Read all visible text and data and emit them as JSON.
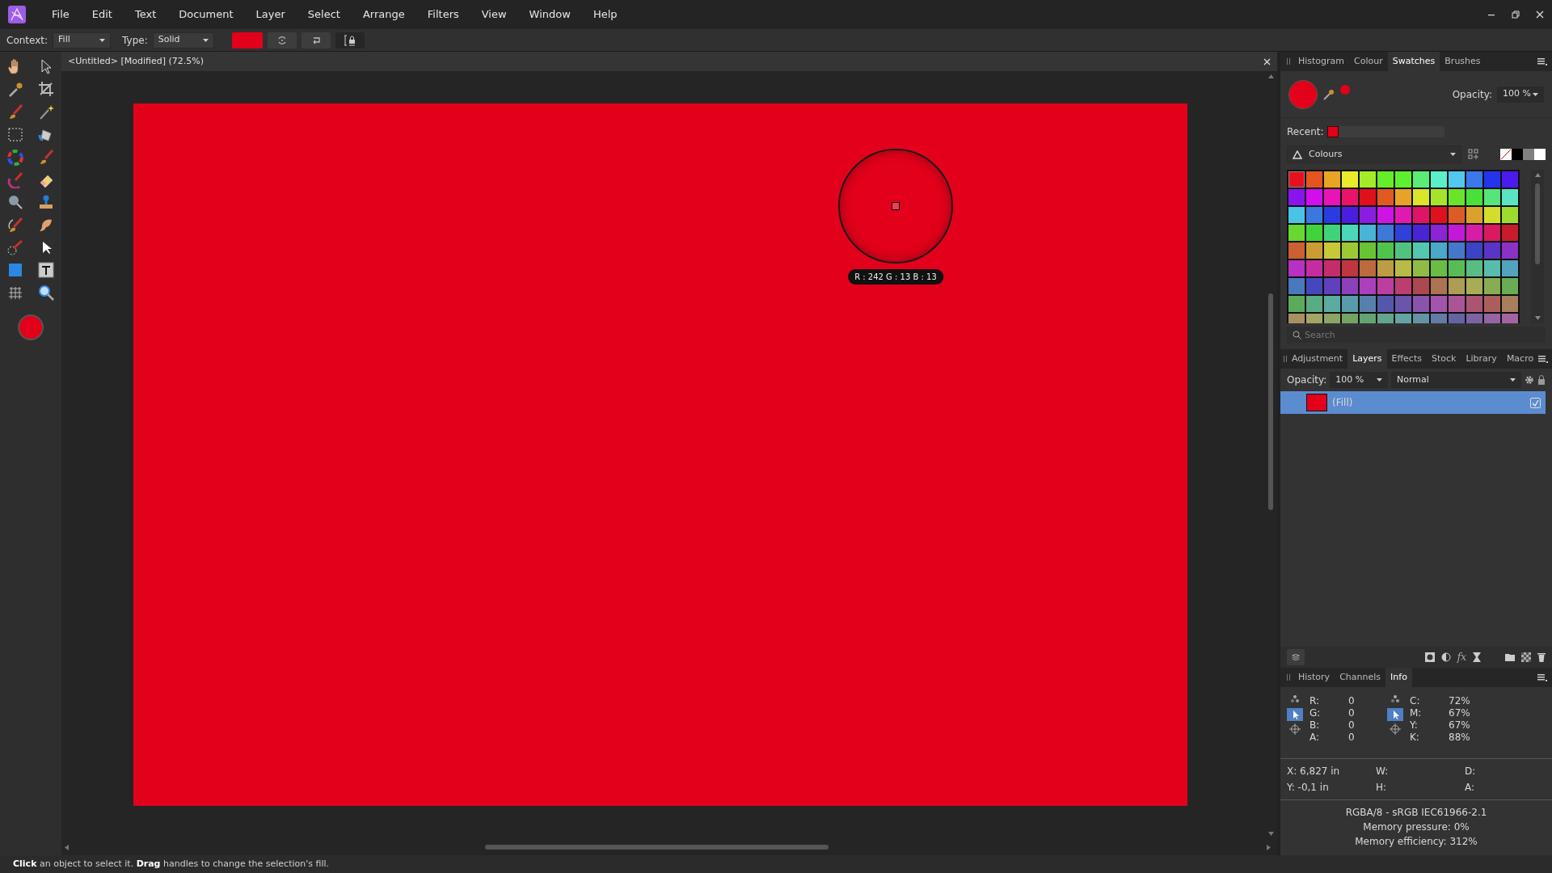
{
  "menu": [
    "File",
    "Edit",
    "Text",
    "Document",
    "Layer",
    "Select",
    "Arrange",
    "Filters",
    "View",
    "Window",
    "Help"
  ],
  "context_bar": {
    "context_label": "Context:",
    "context_value": "Fill",
    "type_label": "Type:",
    "type_value": "Solid",
    "color": "#e2001a"
  },
  "tools": {
    "color": "#e2001a"
  },
  "document": {
    "title": "<Untitled> [Modified] (72.5%)",
    "color": "#e2001a",
    "picker_readout": "R : 242 G : 13 B : 13"
  },
  "swatches_panel": {
    "tabs": [
      {
        "label": "Histogram",
        "selected": false
      },
      {
        "label": "Colour",
        "selected": false
      },
      {
        "label": "Swatches",
        "selected": true
      },
      {
        "label": "Brushes",
        "selected": false
      }
    ],
    "color": "#e2001a",
    "opacity_label": "Opacity:",
    "opacity_value": "100 %",
    "recent_label": "Recent:",
    "recent": [
      {
        "color": "#e2001a"
      }
    ],
    "palette": "Colours",
    "search_placeholder": "Search",
    "swatch_rows": [
      [
        {
          "color": "#e8101e"
        },
        {
          "color": "#e45520"
        },
        {
          "color": "#eaa423"
        },
        {
          "color": "#e8ec2a"
        },
        {
          "color": "#a4ec2a"
        },
        {
          "color": "#66ec28"
        },
        {
          "color": "#5cf030"
        },
        {
          "color": "#5aec74"
        },
        {
          "color": "#5ceec8"
        },
        {
          "color": "#52c8ee"
        },
        {
          "color": "#3a78ec"
        },
        {
          "color": "#2434ec"
        },
        {
          "color": "#4a1aee"
        }
      ],
      [
        {
          "color": "#8a14ee"
        },
        {
          "color": "#d20eee"
        },
        {
          "color": "#e814b8"
        },
        {
          "color": "#e8146a"
        },
        {
          "color": "#e0101c"
        },
        {
          "color": "#e05a22"
        },
        {
          "color": "#e8a22a"
        },
        {
          "color": "#dce42c"
        },
        {
          "color": "#a6e42c"
        },
        {
          "color": "#68e42c"
        },
        {
          "color": "#4ae03c"
        },
        {
          "color": "#56e47c"
        },
        {
          "color": "#5ae4c4"
        }
      ],
      [
        {
          "color": "#4ac4e4"
        },
        {
          "color": "#3a78e0"
        },
        {
          "color": "#2a3ce0"
        },
        {
          "color": "#4a1ee0"
        },
        {
          "color": "#8a1ee0"
        },
        {
          "color": "#ce14e4"
        },
        {
          "color": "#e018b4"
        },
        {
          "color": "#e01466"
        },
        {
          "color": "#e0101e"
        },
        {
          "color": "#dc5c26"
        },
        {
          "color": "#dca02c"
        },
        {
          "color": "#d4dc2e"
        },
        {
          "color": "#9cdc2e"
        }
      ],
      [
        {
          "color": "#68d82e"
        },
        {
          "color": "#40d43a"
        },
        {
          "color": "#40d47a"
        },
        {
          "color": "#4ad8b8"
        },
        {
          "color": "#48b4d8"
        },
        {
          "color": "#3e78d8"
        },
        {
          "color": "#3040d8"
        },
        {
          "color": "#4a24d4"
        },
        {
          "color": "#8a24d4"
        },
        {
          "color": "#c418d8"
        },
        {
          "color": "#d81caa"
        },
        {
          "color": "#d81a60"
        },
        {
          "color": "#c81c2a"
        }
      ],
      [
        {
          "color": "#cc6032"
        },
        {
          "color": "#cc9c32"
        },
        {
          "color": "#c8c836"
        },
        {
          "color": "#9cc836"
        },
        {
          "color": "#68c434"
        },
        {
          "color": "#50c44a"
        },
        {
          "color": "#50c47e"
        },
        {
          "color": "#52c8b0"
        },
        {
          "color": "#4aa8c8"
        },
        {
          "color": "#4478c8"
        },
        {
          "color": "#3a44c4"
        },
        {
          "color": "#5a34c4"
        },
        {
          "color": "#8a32c4"
        }
      ],
      [
        {
          "color": "#b830c4"
        },
        {
          "color": "#c42ca0"
        },
        {
          "color": "#c42c6a"
        },
        {
          "color": "#c03640"
        },
        {
          "color": "#bc6a3e"
        },
        {
          "color": "#bc9c44"
        },
        {
          "color": "#b8bc46"
        },
        {
          "color": "#90bc46"
        },
        {
          "color": "#6abc46"
        },
        {
          "color": "#58bc56"
        },
        {
          "color": "#58bc84"
        },
        {
          "color": "#58bcac"
        },
        {
          "color": "#52a4bc"
        }
      ],
      [
        {
          "color": "#4a78bc"
        },
        {
          "color": "#4448bc"
        },
        {
          "color": "#6040bc"
        },
        {
          "color": "#8c40bc"
        },
        {
          "color": "#ac40bc"
        },
        {
          "color": "#bc3ea0"
        },
        {
          "color": "#bc3e70"
        },
        {
          "color": "#ac4850"
        },
        {
          "color": "#ac7450"
        },
        {
          "color": "#ac9c54"
        },
        {
          "color": "#a8ac54"
        },
        {
          "color": "#88ac54"
        },
        {
          "color": "#68ac54"
        }
      ],
      [
        {
          "color": "#5aac5c"
        },
        {
          "color": "#5aac84"
        },
        {
          "color": "#5aaca0"
        },
        {
          "color": "#589cac"
        },
        {
          "color": "#5880ac"
        },
        {
          "color": "#5458ac"
        },
        {
          "color": "#6a54ac"
        },
        {
          "color": "#8a54ac"
        },
        {
          "color": "#a454ac"
        },
        {
          "color": "#ac5498"
        },
        {
          "color": "#ac5474"
        },
        {
          "color": "#ac5e5c"
        },
        {
          "color": "#a87e5c"
        }
      ],
      [
        {
          "color": "#a89060"
        },
        {
          "color": "#a4a464"
        },
        {
          "color": "#8ca464"
        },
        {
          "color": "#74a464"
        },
        {
          "color": "#64a470"
        },
        {
          "color": "#64a48c"
        },
        {
          "color": "#64a4a4"
        },
        {
          "color": "#6494a4"
        },
        {
          "color": "#647ca4"
        },
        {
          "color": "#6464a4"
        },
        {
          "color": "#7c64a4"
        },
        {
          "color": "#9464a4"
        },
        {
          "color": "#a464a4"
        }
      ]
    ]
  },
  "layers_panel": {
    "tabs": [
      {
        "label": "Adjustment",
        "selected": false
      },
      {
        "label": "Layers",
        "selected": true
      },
      {
        "label": "Effects",
        "selected": false
      },
      {
        "label": "Stock",
        "selected": false
      },
      {
        "label": "Library",
        "selected": false
      },
      {
        "label": "Macro",
        "selected": false
      }
    ],
    "opacity_label": "Opacity:",
    "opacity_value": "100 %",
    "blend_mode": "Normal",
    "layers": [
      {
        "name": "(Fill)",
        "color": "#e2001a",
        "selected": true,
        "visible": true
      }
    ],
    "fx_label": "fx"
  },
  "info_panel": {
    "tabs": [
      {
        "label": "History",
        "selected": false
      },
      {
        "label": "Channels",
        "selected": false
      },
      {
        "label": "Info",
        "selected": true
      }
    ],
    "left_modes": [
      {
        "selected": false
      },
      {
        "selected": true
      },
      {
        "selected": false
      }
    ],
    "right_modes": [
      {
        "selected": false
      },
      {
        "selected": true
      },
      {
        "selected": false
      }
    ],
    "rgb": [
      {
        "label": "R:",
        "value": "0"
      },
      {
        "label": "G:",
        "value": "0"
      },
      {
        "label": "B:",
        "value": "0"
      },
      {
        "label": "A:",
        "value": "0"
      }
    ],
    "cmyk": [
      {
        "label": "C:",
        "value": "72%"
      },
      {
        "label": "M:",
        "value": "67%"
      },
      {
        "label": "Y:",
        "value": "67%"
      },
      {
        "label": "K:",
        "value": "88%"
      }
    ],
    "position": [
      {
        "label": "X:",
        "value": "6,827 in"
      },
      {
        "label": "Y:",
        "value": "-0,1 in"
      }
    ],
    "size": [
      "W:",
      "H:"
    ],
    "other": [
      "D:",
      "A:"
    ],
    "summary": [
      "RGBA/8 - sRGB IEC61966-2.1",
      "Memory pressure: 0%",
      "Memory efficiency: 312%"
    ]
  },
  "status_bar": "**Click** an object to select it. **Drag** handles to change the selection's fill."
}
